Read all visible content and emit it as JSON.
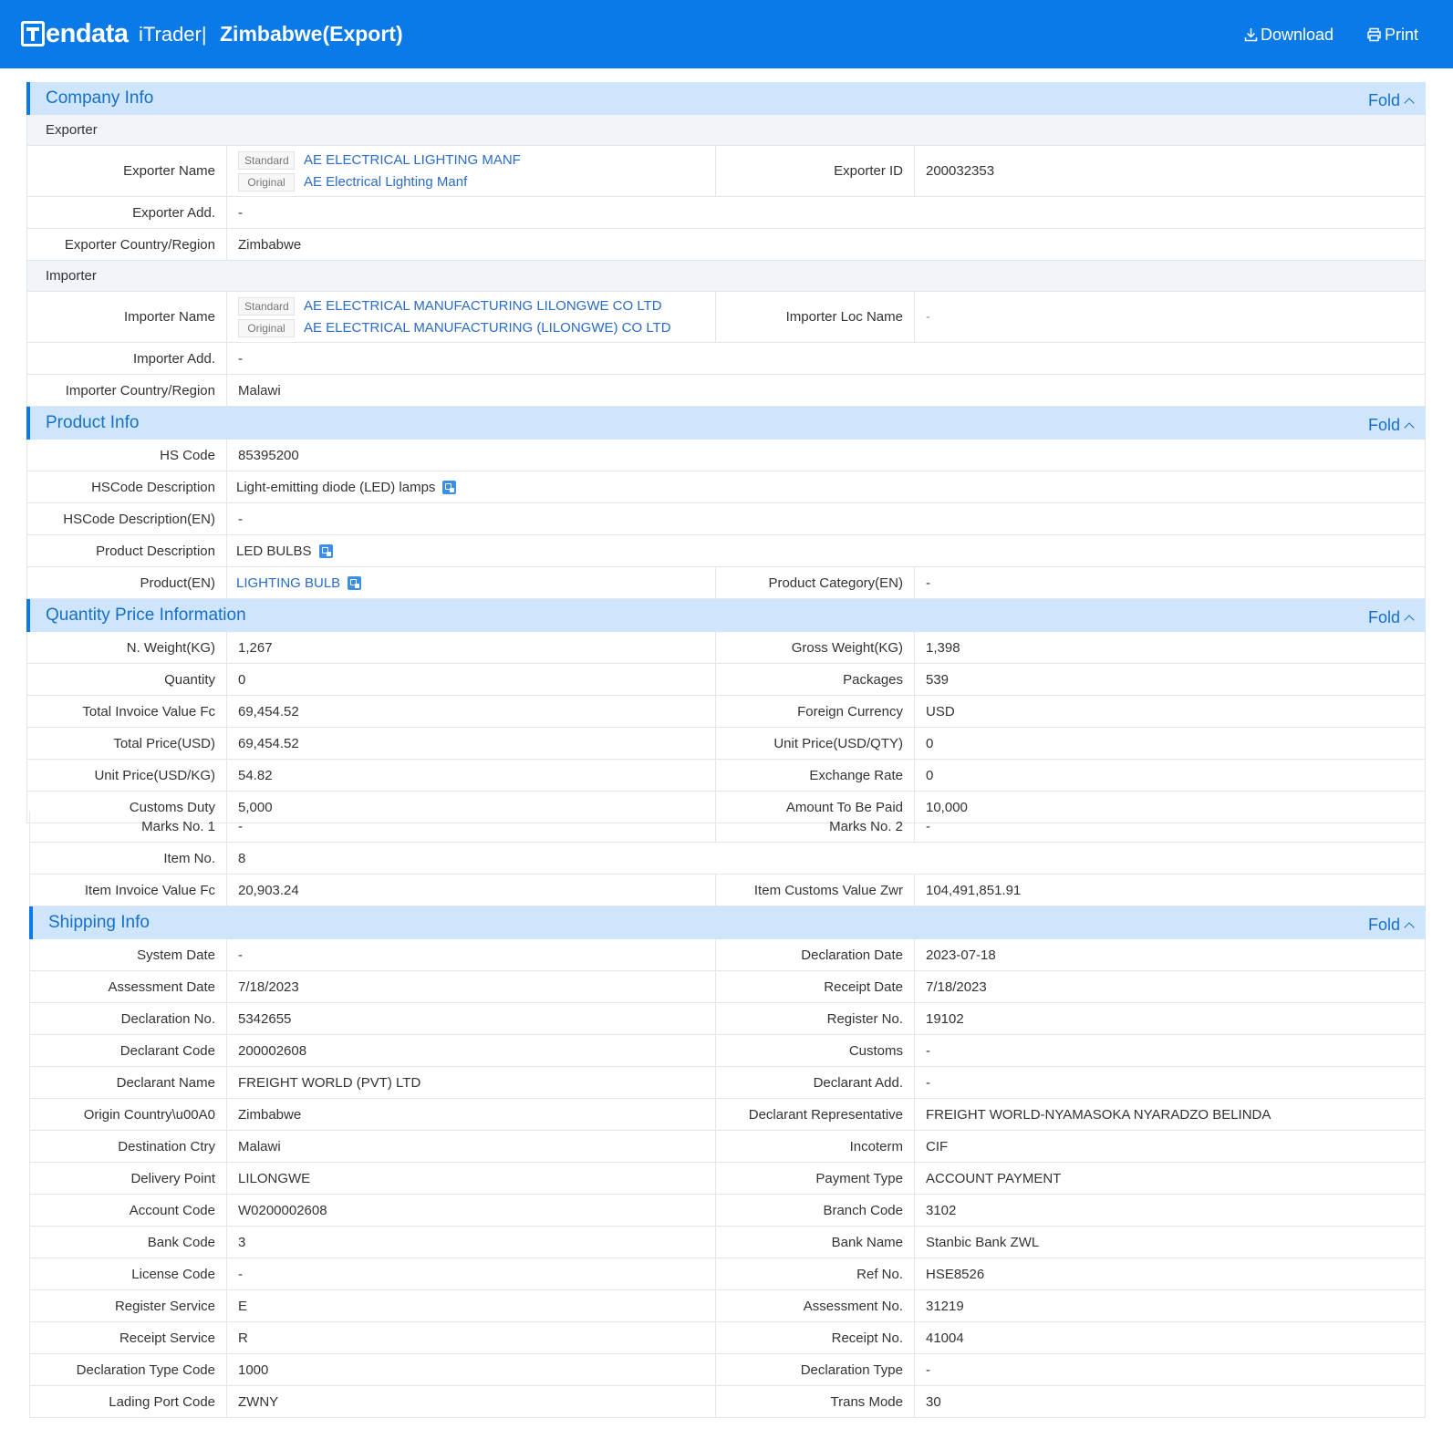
{
  "header": {
    "logo_text": "endata",
    "product": "iTrader|",
    "title": "Zimbabwe(Export)",
    "download_label": "Download",
    "print_label": "Print"
  },
  "fold_label": "Fold",
  "company": {
    "title": "Company Info",
    "exporter_heading": "Exporter",
    "importer_heading": "Importer",
    "tag_standard": "Standard",
    "tag_original": "Original",
    "exporter_name_label": "Exporter Name",
    "exporter_name_standard": "AE ELECTRICAL LIGHTING MANF",
    "exporter_name_original": "AE Electrical Lighting Manf",
    "exporter_id_label": "Exporter ID",
    "exporter_id": "200032353",
    "exporter_add_label": "Exporter Add.",
    "exporter_add": "-",
    "exporter_country_label": "Exporter Country/Region",
    "exporter_country": "Zimbabwe",
    "importer_name_label": "Importer Name",
    "importer_name_standard": "AE ELECTRICAL MANUFACTURING LILONGWE CO LTD",
    "importer_name_original": "AE ELECTRICAL MANUFACTURING (LILONGWE) CO LTD",
    "importer_loc_label": "Importer Loc Name",
    "importer_loc": "-",
    "importer_add_label": "Importer Add.",
    "importer_add": "-",
    "importer_country_label": "Importer Country/Region",
    "importer_country": "Malawi"
  },
  "product": {
    "title": "Product Info",
    "hs_code_label": "HS Code",
    "hs_code": "85395200",
    "hs_desc_label": "HSCode Description",
    "hs_desc": "Light-emitting diode (LED) lamps",
    "hs_desc_en_label": "HSCode Description(EN)",
    "hs_desc_en": "-",
    "prod_desc_label": "Product Description",
    "prod_desc": "LED BULBS",
    "product_en_label": "Product(EN)",
    "product_en": "LIGHTING BULB",
    "category_en_label": "Product Category(EN)",
    "category_en": "-"
  },
  "quantity": {
    "title": "Quantity Price Information",
    "rows": [
      {
        "l1": "N. Weight(KG)",
        "v1": "1,267",
        "l2": "Gross Weight(KG)",
        "v2": "1,398"
      },
      {
        "l1": "Quantity",
        "v1": "0",
        "l2": "Packages",
        "v2": "539"
      },
      {
        "l1": "Total Invoice Value Fc",
        "v1": "69,454.52",
        "l2": "Foreign Currency",
        "v2": "USD"
      },
      {
        "l1": "Total Price(USD)",
        "v1": "69,454.52",
        "l2": "Unit Price(USD/QTY)",
        "v2": "0"
      },
      {
        "l1": "Unit Price(USD/KG)",
        "v1": "54.82",
        "l2": "Exchange Rate",
        "v2": "0"
      },
      {
        "l1": "Customs Duty",
        "v1": "5,000",
        "l2": "Amount To Be Paid",
        "v2": "10,000"
      }
    ],
    "marks1_label": "Marks No. 1",
    "marks1": "-",
    "marks2_label": "Marks No. 2",
    "marks2": "-",
    "item_no_label": "Item No.",
    "item_no": "8",
    "item_invoice_label": "Item Invoice Value Fc",
    "item_invoice": "20,903.24",
    "item_customs_label": "Item Customs Value Zwr",
    "item_customs": "104,491,851.91"
  },
  "shipping": {
    "title": "Shipping Info",
    "rows": [
      {
        "l1": "System Date",
        "v1": "-",
        "l2": "Declaration Date",
        "v2": "2023-07-18"
      },
      {
        "l1": "Assessment Date",
        "v1": "7/18/2023",
        "l2": "Receipt Date",
        "v2": "7/18/2023"
      },
      {
        "l1": "Declaration No.",
        "v1": "5342655",
        "l2": "Register No.",
        "v2": "19102"
      },
      {
        "l1": "Declarant Code",
        "v1": "200002608",
        "l2": "Customs",
        "v2": "-"
      },
      {
        "l1": "Declarant Name",
        "v1": "FREIGHT WORLD (PVT) LTD",
        "l2": "Declarant Add.",
        "v2": "-"
      },
      {
        "l1": "Origin Country\\u00A0",
        "v1": "Zimbabwe",
        "l2": "Declarant Representative",
        "v2": "FREIGHT WORLD-NYAMASOKA NYARADZO BELINDA"
      },
      {
        "l1": "Destination Ctry",
        "v1": "Malawi",
        "l2": "Incoterm",
        "v2": "CIF"
      },
      {
        "l1": "Delivery Point",
        "v1": "LILONGWE",
        "l2": "Payment Type",
        "v2": "ACCOUNT PAYMENT"
      },
      {
        "l1": "Account Code",
        "v1": "W0200002608",
        "l2": "Branch Code",
        "v2": "3102"
      },
      {
        "l1": "Bank Code",
        "v1": "3",
        "l2": "Bank Name",
        "v2": "Stanbic Bank ZWL"
      },
      {
        "l1": "License Code",
        "v1": "-",
        "l2": "Ref No.",
        "v2": "HSE8526"
      },
      {
        "l1": "Register Service",
        "v1": "E",
        "l2": "Assessment No.",
        "v2": "31219"
      },
      {
        "l1": "Receipt Service",
        "v1": "R",
        "l2": "Receipt No.",
        "v2": "41004"
      },
      {
        "l1": "Declaration Type Code",
        "v1": "1000",
        "l2": "Declaration Type",
        "v2": "-"
      },
      {
        "l1": "Lading Port Code",
        "v1": "ZWNY",
        "l2": "Trans Mode",
        "v2": "30"
      }
    ]
  },
  "icons": {
    "download": "download-icon",
    "print": "printer-icon",
    "translate": "translate-icon",
    "fold": "chevron-up-icon"
  },
  "colors": {
    "brand": "#0a7ae8",
    "section_bg": "#cfe5fb",
    "link": "#2b6cc4"
  }
}
